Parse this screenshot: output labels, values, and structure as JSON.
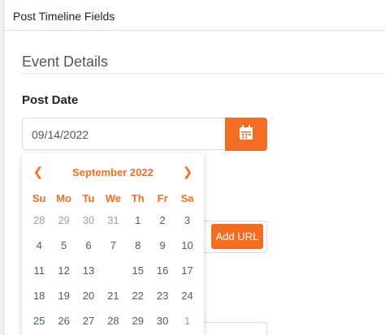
{
  "header": {
    "title": "Post Timeline Fields"
  },
  "section": {
    "title": "Event Details"
  },
  "post_date": {
    "label": "Post Date",
    "value": "09/14/2022",
    "button_icon": "calendar-icon"
  },
  "add_url": {
    "label": "Add URL"
  },
  "datepicker": {
    "month_label": "September 2022",
    "prev_icon": "chevron-left-icon",
    "next_icon": "chevron-right-icon",
    "weekdays": [
      "Su",
      "Mo",
      "Tu",
      "We",
      "Th",
      "Fr",
      "Sa"
    ],
    "days": [
      {
        "label": "28",
        "muted": true
      },
      {
        "label": "29",
        "muted": true
      },
      {
        "label": "30",
        "muted": true
      },
      {
        "label": "31",
        "muted": true
      },
      {
        "label": "1",
        "muted": false
      },
      {
        "label": "2",
        "muted": false
      },
      {
        "label": "3",
        "muted": false
      },
      {
        "label": "4",
        "muted": false
      },
      {
        "label": "5",
        "muted": false
      },
      {
        "label": "6",
        "muted": false
      },
      {
        "label": "7",
        "muted": false
      },
      {
        "label": "8",
        "muted": false
      },
      {
        "label": "9",
        "muted": false
      },
      {
        "label": "10",
        "muted": false
      },
      {
        "label": "11",
        "muted": false
      },
      {
        "label": "12",
        "muted": false
      },
      {
        "label": "13",
        "muted": false
      },
      {
        "label": "",
        "muted": false
      },
      {
        "label": "15",
        "muted": false
      },
      {
        "label": "16",
        "muted": false
      },
      {
        "label": "17",
        "muted": false
      },
      {
        "label": "18",
        "muted": false
      },
      {
        "label": "19",
        "muted": false
      },
      {
        "label": "20",
        "muted": false
      },
      {
        "label": "21",
        "muted": false
      },
      {
        "label": "22",
        "muted": false
      },
      {
        "label": "23",
        "muted": false
      },
      {
        "label": "24",
        "muted": false
      },
      {
        "label": "25",
        "muted": false
      },
      {
        "label": "26",
        "muted": false
      },
      {
        "label": "27",
        "muted": false
      },
      {
        "label": "28",
        "muted": false
      },
      {
        "label": "29",
        "muted": false
      },
      {
        "label": "30",
        "muted": false
      },
      {
        "label": "1",
        "muted": true
      }
    ]
  },
  "colors": {
    "accent": "#f36c23",
    "day_text": "#4a5a80",
    "muted_day": "#9aa1b4"
  }
}
